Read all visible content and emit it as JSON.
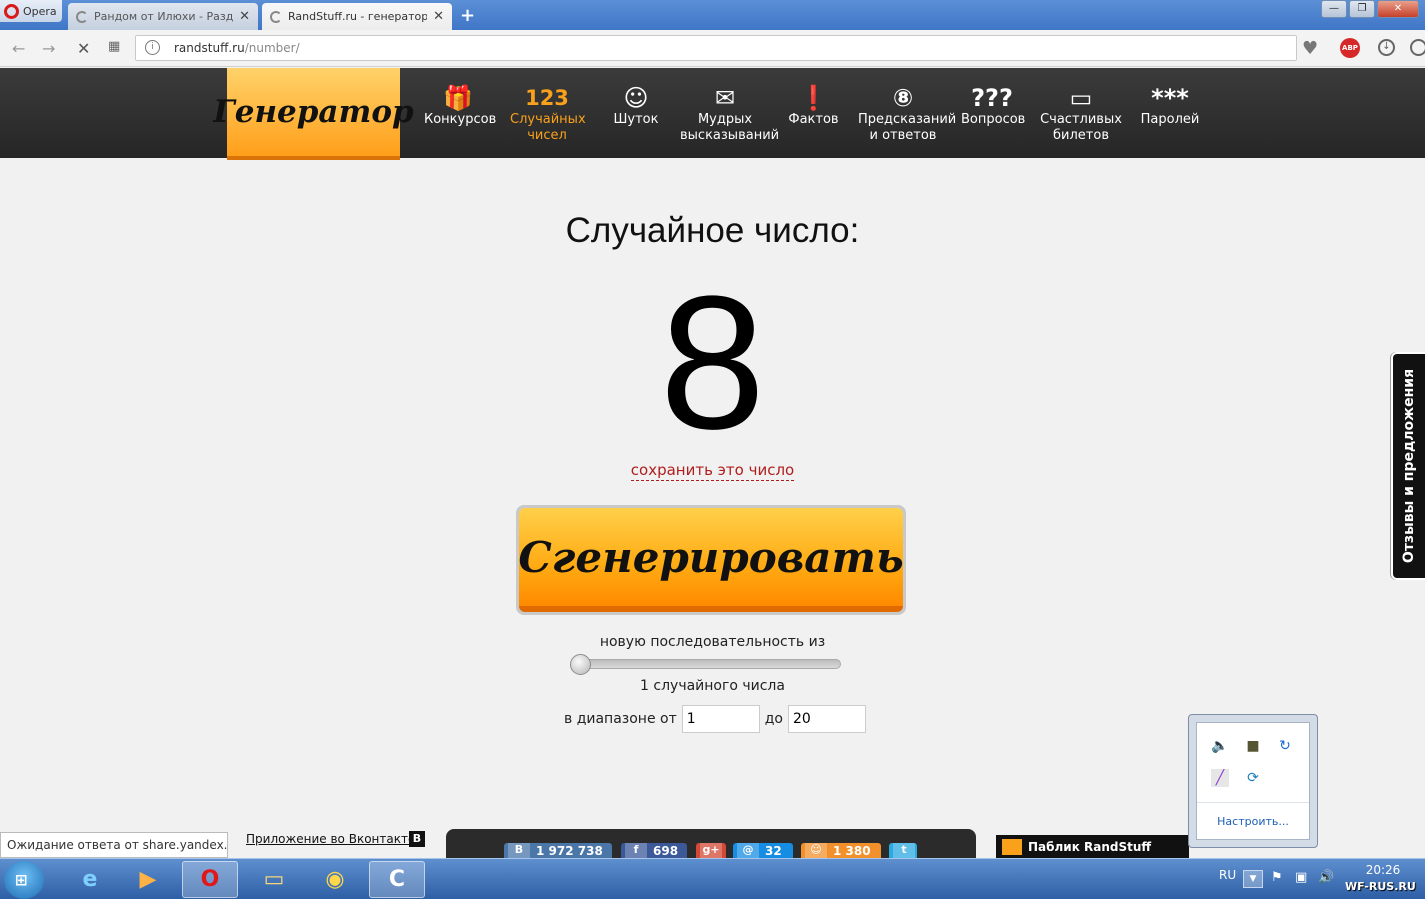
{
  "browser": {
    "opera_label": "Opera",
    "tabs": [
      {
        "title": "Рандом от Илюхи - Раздача"
      },
      {
        "title": "RandStuff.ru - генератор случайных"
      }
    ],
    "url_host": "randstuff.ru",
    "url_path": "/number/"
  },
  "site": {
    "logo": "Генератор",
    "nav": [
      {
        "icon": "🎁",
        "label": "Конкурсов"
      },
      {
        "icon": "123",
        "label": "Случайных чисел"
      },
      {
        "icon": "☺",
        "label": "Шуток"
      },
      {
        "icon": "✉",
        "label": "Мудрых высказываний"
      },
      {
        "icon": "❗",
        "label": "Фактов"
      },
      {
        "icon": "⑧",
        "label": "Предсказаний и ответов"
      },
      {
        "icon": "???",
        "label": "Вопросов"
      },
      {
        "icon": "▭",
        "label": "Счастливых билетов"
      },
      {
        "icon": "***",
        "label": "Паролей"
      }
    ]
  },
  "main": {
    "heading": "Случайное число:",
    "number": "8",
    "save_link": "сохранить это число",
    "generate_button": "Сгенерировать",
    "sequence_label": "новую последовательность из",
    "slider_value": 1,
    "count_label": "1 случайного числа",
    "range_from_label": "в диапазоне от",
    "range_from": "1",
    "range_to_label": "до",
    "range_to": "20",
    "feedback": "Отзывы и предложения"
  },
  "footer": {
    "status": "Ожидание ответа от share.yandex.net...",
    "vk_app": "Приложение во Вконтакте",
    "vk_badge": "В",
    "shares": [
      {
        "icon": "В",
        "count": "1 972 738",
        "color": "#4a76a8"
      },
      {
        "icon": "f",
        "count": "698",
        "color": "#3b5998"
      },
      {
        "icon": "g+",
        "count": "",
        "color": "#d34836"
      },
      {
        "icon": "@",
        "count": "32",
        "color": "#168de2"
      },
      {
        "icon": "☺",
        "count": "1 380",
        "color": "#f2912b"
      },
      {
        "icon": "t",
        "count": "",
        "color": "#2ba9e1"
      }
    ],
    "public_label": "Паблик RandStuff"
  },
  "tray_popup": {
    "configure_label": "Настроить..."
  },
  "taskbar": {
    "lang": "RU",
    "time": "20:26",
    "watermark": "WF-RUS.RU"
  }
}
